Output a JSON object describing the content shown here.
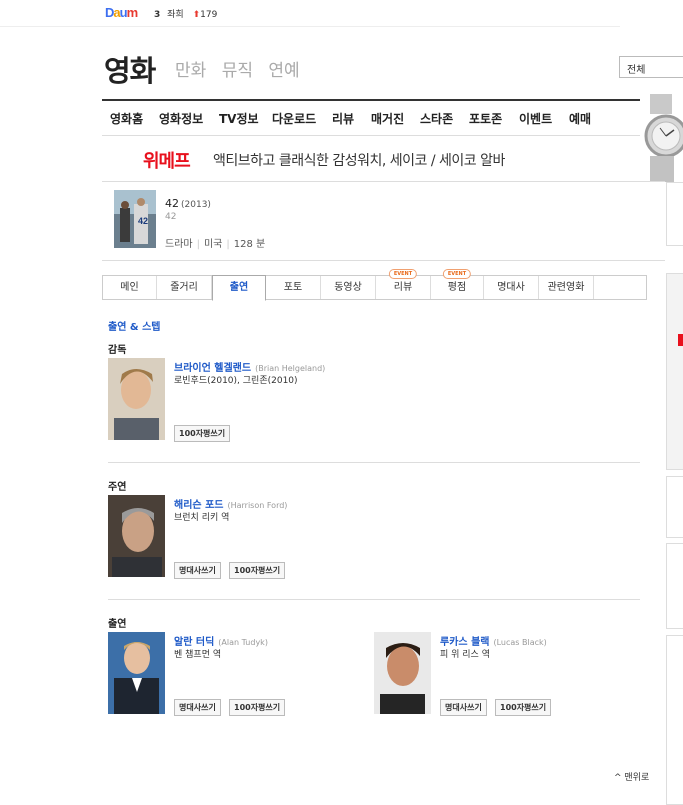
{
  "topbar": {
    "logo": [
      "D",
      "a",
      "u",
      "m"
    ],
    "rank_number": "3",
    "rank_label": "좌희",
    "rank_change": "179"
  },
  "category": {
    "title": "영화",
    "subs": [
      "만화",
      "뮤직",
      "연예"
    ],
    "search_scope": "전체"
  },
  "nav": [
    "영화홈",
    "영화정보",
    "TV정보",
    "다운로드",
    "리뷰",
    "매거진",
    "스타존",
    "포토존",
    "이벤트",
    "예매"
  ],
  "banner": {
    "brand": "위메프",
    "text": "액티브하고 클래식한 감성워치, 세이코 / 세이코 알바"
  },
  "movie": {
    "title": "42",
    "year": "(2013)",
    "subtitle": "42",
    "genre": "드라마",
    "country": "미국",
    "runtime": "128 분",
    "poster_text": "42"
  },
  "tabs": [
    {
      "label": "메인",
      "event": ""
    },
    {
      "label": "줄거리",
      "event": ""
    },
    {
      "label": "출연",
      "event": ""
    },
    {
      "label": "포토",
      "event": ""
    },
    {
      "label": "동영상",
      "event": ""
    },
    {
      "label": "리뷰",
      "event": "EVENT"
    },
    {
      "label": "평점",
      "event": "EVENT"
    },
    {
      "label": "명대사",
      "event": ""
    },
    {
      "label": "관련영화",
      "event": ""
    }
  ],
  "cast": {
    "section_title": "출연 & 스텝",
    "director_label": "감독",
    "director": {
      "name": "브라이언 헬겔랜드",
      "en": "(Brian Helgeland)",
      "desc": "로빈후드(2010), 그린존(2010)",
      "btn_review": "100자평쓰기"
    },
    "lead_label": "주연",
    "lead": {
      "name": "해리슨 포드",
      "en": "(Harrison Ford)",
      "desc": "브런치 리키 역",
      "btn_quote": "명대사쓰기",
      "btn_review": "100자평쓰기"
    },
    "support_label": "출연",
    "support": [
      {
        "name": "알란 터딕",
        "en": "(Alan Tudyk)",
        "desc": "벤 챔프먼 역",
        "btn_quote": "명대사쓰기",
        "btn_review": "100자평쓰기"
      },
      {
        "name": "루카스 블랙",
        "en": "(Lucas Black)",
        "desc": "피 위 리스 역",
        "btn_quote": "명대사쓰기",
        "btn_review": "100자평쓰기"
      }
    ]
  },
  "footer": {
    "to_top": "^ 맨위로"
  },
  "colors": {
    "link_blue": "#1f5ac8",
    "brand_red": "#e8101d",
    "event_orange": "#e86a1a"
  }
}
